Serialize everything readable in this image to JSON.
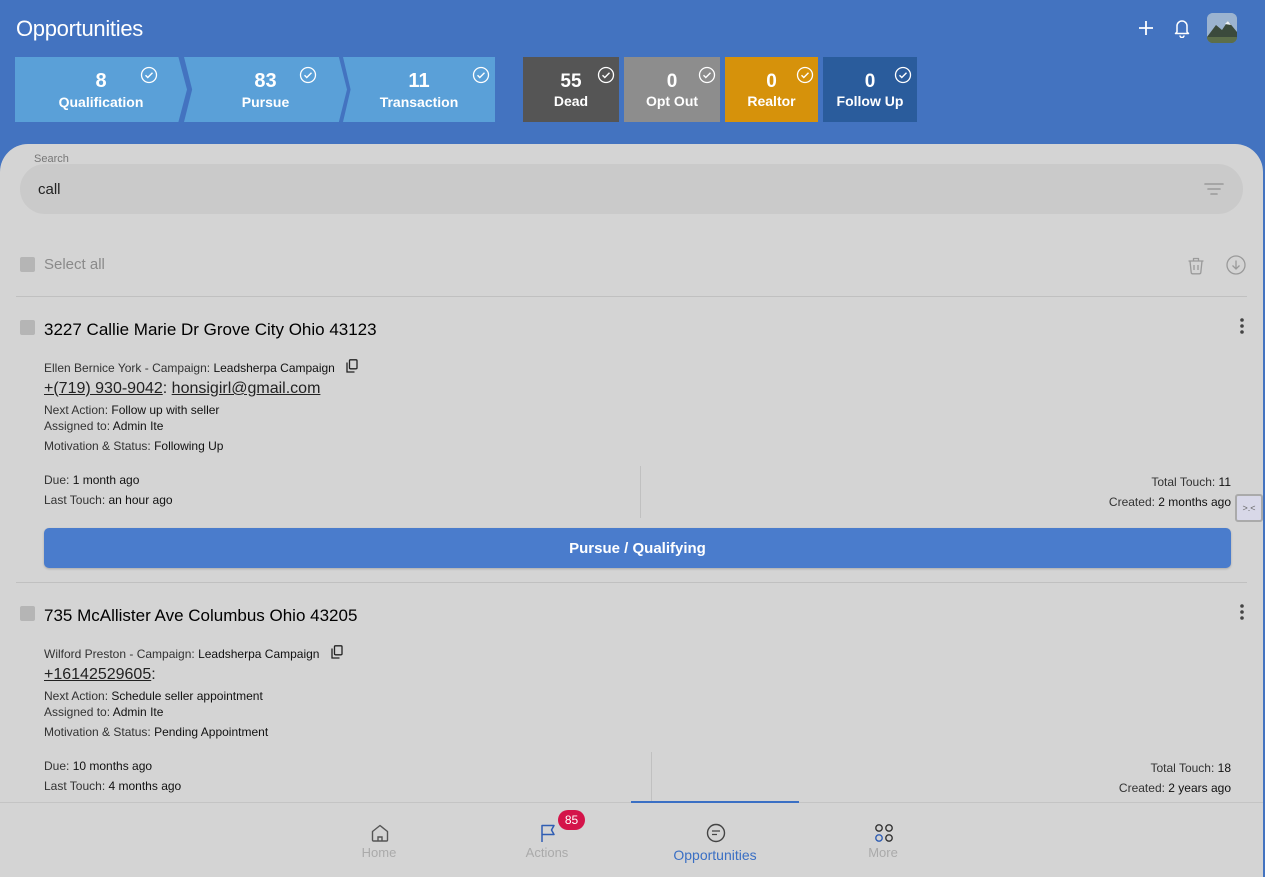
{
  "app": {
    "title": "Opportunities"
  },
  "stages": [
    {
      "count": "8",
      "label": "Qualification"
    },
    {
      "count": "83",
      "label": "Pursue"
    },
    {
      "count": "11",
      "label": "Transaction"
    },
    {
      "count": "55",
      "label": "Dead"
    },
    {
      "count": "0",
      "label": "Opt Out"
    },
    {
      "count": "0",
      "label": "Realtor"
    },
    {
      "count": "0",
      "label": "Follow Up"
    }
  ],
  "colors": {
    "header": "#4373c0",
    "stage_arrow": "#5aa0d8",
    "dead": "#555555",
    "opt_out": "#8d8d8d",
    "realtor": "#d6920b",
    "follow_up": "#2a5c9c",
    "accent": "#4a7ccc",
    "badge": "#d4144a"
  },
  "search": {
    "label": "Search",
    "value": "call"
  },
  "list": {
    "select_all": "Select all"
  },
  "cards": [
    {
      "address": "3227 Callie Marie Dr Grove City Ohio 43123",
      "owner": "Ellen Bernice York",
      "campaign_prefix": " - Campaign: ",
      "campaign": "Leadsherpa Campaign",
      "phone": "+(719) 930-9042",
      "sep": ":",
      "email": "honsigirl@gmail.com",
      "next_action_label": "Next Action: ",
      "next_action": "Follow up with seller",
      "assigned_label": "Assigned to: ",
      "assigned": "Admin Ite",
      "status_label": "Motivation & Status: ",
      "status": "Following Up",
      "due_label": "Due: ",
      "due": "1 month ago",
      "last_touch_label": "Last Touch: ",
      "last_touch": "an hour ago",
      "total_touch_label": "Total Touch: ",
      "total_touch": "11",
      "created_label": "Created: ",
      "created": "2 months ago",
      "action": "Pursue / Qualifying"
    },
    {
      "address": "735 McAllister Ave Columbus Ohio 43205",
      "owner": "Wilford Preston",
      "campaign_prefix": " - Campaign: ",
      "campaign": "Leadsherpa Campaign",
      "phone": "+16142529605",
      "sep": ":",
      "email": "",
      "next_action_label": "Next Action: ",
      "next_action": "Schedule seller appointment",
      "assigned_label": "Assigned to: ",
      "assigned": "Admin Ite",
      "status_label": "Motivation & Status: ",
      "status": "Pending Appointment",
      "due_label": "Due: ",
      "due": "10 months ago",
      "last_touch_label": "Last Touch: ",
      "last_touch": "4 months ago",
      "total_touch_label": "Total Touch: ",
      "total_touch": "18",
      "created_label": "Created: ",
      "created": "2 years ago"
    }
  ],
  "side_tab": ">.<",
  "nav": [
    {
      "label": "Home",
      "icon": "home-icon"
    },
    {
      "label": "Actions",
      "icon": "flag-icon",
      "badge": "85"
    },
    {
      "label": "Opportunities",
      "icon": "chat-icon",
      "active": true
    },
    {
      "label": "More",
      "icon": "grid-icon"
    }
  ]
}
